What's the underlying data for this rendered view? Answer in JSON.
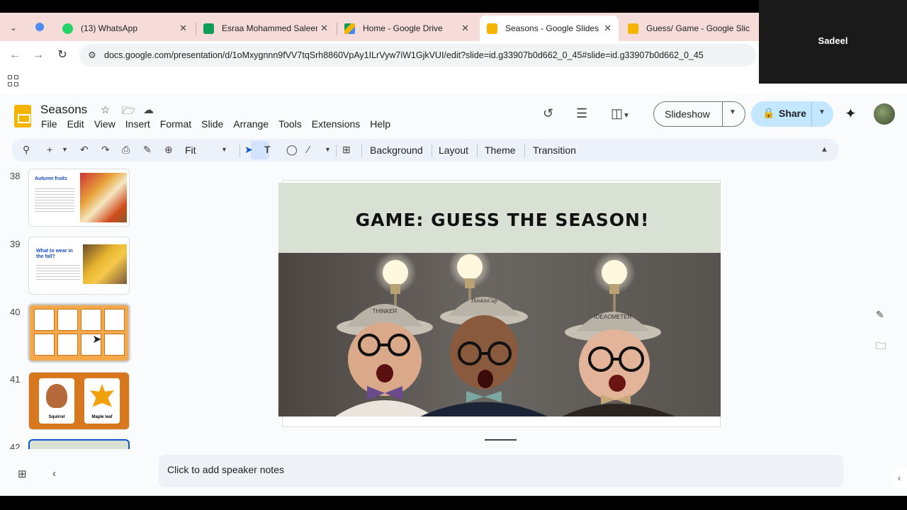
{
  "browser": {
    "tabs": [
      {
        "label": "(13) WhatsApp",
        "icon": "whatsapp-icon",
        "color": "#25d366"
      },
      {
        "label": "Esraa Mohammed Saleem",
        "icon": "sheets-icon",
        "color": "#0f9d58"
      },
      {
        "label": "Home - Google Drive",
        "icon": "drive-icon",
        "color": "#4285f4"
      },
      {
        "label": "Seasons - Google Slides",
        "icon": "slides-icon",
        "color": "#f4b400"
      },
      {
        "label": "Guess/ Game - Google Slic",
        "icon": "slides-icon",
        "color": "#f4b400"
      }
    ],
    "url": "docs.google.com/presentation/d/1oMxygnnn9fVV7tqSrh8860VpAy1ILrVyw7iW1GjkVUI/edit?slide=id.g33907b0d662_0_45#slide=id.g33907b0d662_0_45"
  },
  "video": {
    "name": "Sadeel"
  },
  "doc": {
    "title": "Seasons",
    "menu": [
      "File",
      "Edit",
      "View",
      "Insert",
      "Format",
      "Slide",
      "Arrange",
      "Tools",
      "Extensions",
      "Help"
    ],
    "slideshow_label": "Slideshow",
    "share_label": "Share"
  },
  "toolbar": {
    "zoom": "Fit",
    "background": "Background",
    "layout": "Layout",
    "theme": "Theme",
    "transition": "Transition"
  },
  "filmstrip": {
    "slides": [
      {
        "num": "38",
        "title": "Autumn fruits"
      },
      {
        "num": "39",
        "title": "What to wear in the fall?"
      },
      {
        "num": "40",
        "title": ""
      },
      {
        "num": "41",
        "labels": [
          "Squirrel",
          "Maple leaf"
        ]
      },
      {
        "num": "42",
        "title": ""
      }
    ]
  },
  "slide": {
    "title": "GAME: GUESS THE SEASON!",
    "hat_labels": [
      "THINKER",
      "ThinkinCap",
      "IDEAOMETER"
    ]
  },
  "notes": {
    "placeholder": "Click to add speaker notes"
  },
  "colors": {
    "accent": "#0b57d0",
    "share_bg": "#c2e7ff",
    "tab_strip": "#f6dcd9",
    "slide_bg": "#d9e1d4"
  }
}
